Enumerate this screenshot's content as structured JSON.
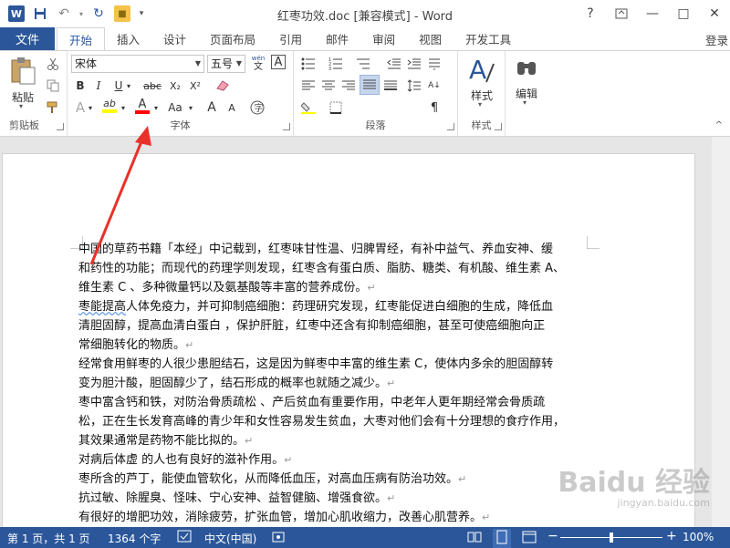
{
  "titlebar": {
    "title": "红枣功效.doc [兼容模式] - Word",
    "help": "?",
    "minimize": "—",
    "maximize": "□",
    "close": "✕"
  },
  "qat": {
    "word_logo": "W",
    "save": "💾",
    "undo": "↶",
    "redo": "↻",
    "lock": "🔒",
    "more": "▾"
  },
  "tabs": {
    "file": "文件",
    "items": [
      "开始",
      "插入",
      "设计",
      "页面布局",
      "引用",
      "邮件",
      "审阅",
      "视图",
      "开发工具"
    ],
    "login": "登录"
  },
  "ribbon": {
    "clipboard": {
      "label": "剪贴板",
      "paste": "粘贴"
    },
    "font": {
      "label": "字体",
      "font_name": "宋体",
      "font_size": "五号",
      "wen": "wén",
      "wen2": "文",
      "A_box": "A",
      "bold": "B",
      "italic": "I",
      "underline": "U",
      "strike": "abc",
      "sub": "X₂",
      "sup": "X²",
      "effects": "A",
      "highlight": "ab",
      "fontcolor": "A",
      "changecase": "Aa",
      "grow": "A",
      "shrink": "A",
      "clear": "A"
    },
    "paragraph": {
      "label": "段落"
    },
    "styles": {
      "label": "样式",
      "btn": "样式"
    },
    "editing": {
      "label": "",
      "btn": "编辑"
    }
  },
  "document": {
    "lines": [
      "中国的草药书籍「本经」中记载到，红枣味甘性温、归脾胃经，有补中益气、养血安神、缓",
      "和药性的功能；而现代的药理学则发现，红枣含有蛋白质、脂肪、糖类、有机酸、维生素 A、",
      "维生素 C 、多种微量钙以及氨基酸等丰富的营养成份。",
      "枣能提高人体免疫力，并可抑制癌细胞：药理研究发现，红枣能促进白细胞的生成，降低血",
      "清胆固醇，提高血清白蛋白 ，保护肝脏，红枣中还含有抑制癌细胞，甚至可使癌细胞向正",
      "常细胞转化的物质。",
      "经常食用鲜枣的人很少患胆结石，这是因为鲜枣中丰富的维生素 C，使体内多余的胆固醇转",
      "变为胆汁酸，胆固醇少了，结石形成的概率也就随之减少。",
      "枣中富含钙和铁，对防治骨质疏松 、产后贫血有重要作用，中老年人更年期经常会骨质疏",
      "松，正在生长发育高峰的青少年和女性容易发生贫血，大枣对他们会有十分理想的食疗作用，",
      "其效果通常是药物不能比拟的。",
      "对病后体虚 的人也有良好的滋补作用。",
      "枣所含的芦丁，能使血管软化，从而降低血压，对高血压病有防治功效。",
      "抗过敏、除腥臭、怪味、宁心安神、益智健脑、增强食欲。",
      "有很好的增肥功效，消除疲劳，扩张血管，增加心肌收缩力，改善心肌营养。"
    ],
    "line_ends": [
      "",
      "",
      "↵",
      "",
      "",
      "↵",
      "",
      "↵",
      "",
      "",
      "↵",
      "↵",
      "↵",
      "↵",
      "↵"
    ],
    "wavy_word": "枣能提高"
  },
  "watermark": {
    "main": "Baidu 经验",
    "sub": "jingyan.baidu.com"
  },
  "statusbar": {
    "page": "第 1 页，共 1 页",
    "words": "1364 个字",
    "lang": "中文(中国)",
    "zoom": "100%",
    "minus": "−",
    "plus": "+"
  },
  "colors": {
    "accent": "#2b579a",
    "arrow": "#e8312a",
    "highlight_bar": "#ffff00",
    "fontcolor_bar": "#ff0000"
  }
}
